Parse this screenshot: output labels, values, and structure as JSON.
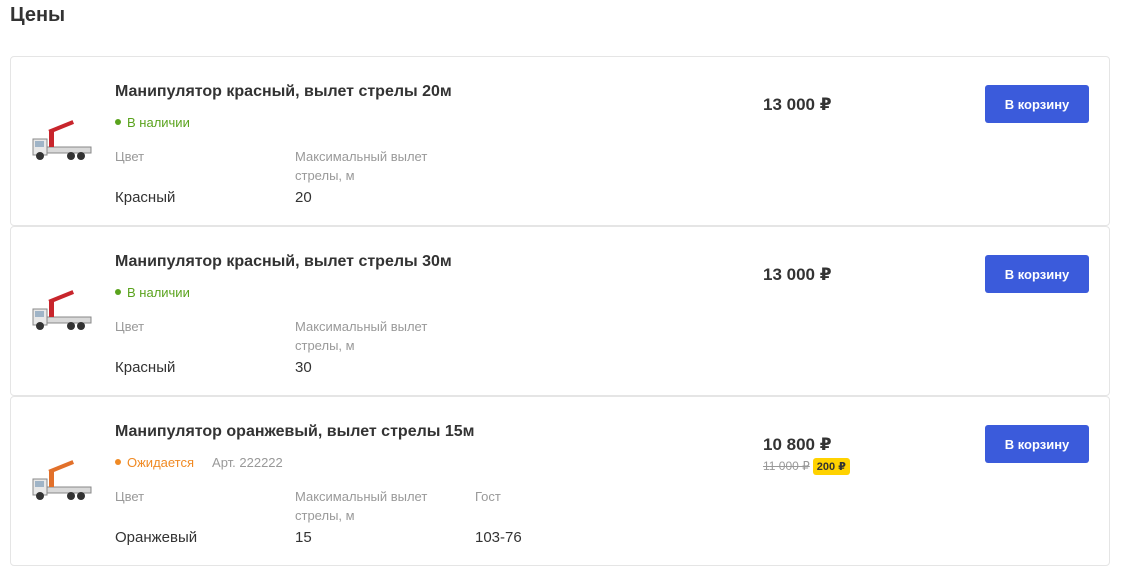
{
  "page": {
    "title": "Цены"
  },
  "products": [
    {
      "title": "Манипулятор красный, вылет стрелы 20м",
      "status": "В наличии",
      "status_type": "in-stock",
      "sku": "",
      "properties": [
        {
          "label": "Цвет",
          "value": "Красный"
        },
        {
          "label": "Максимальный вылет стрелы, м",
          "value": "20"
        }
      ],
      "price": "13 000 ₽",
      "old_price": "",
      "discount": "",
      "button_label": "В корзину",
      "crane_color": "#c8252c"
    },
    {
      "title": "Манипулятор красный, вылет стрелы 30м",
      "status": "В наличии",
      "status_type": "in-stock",
      "sku": "",
      "properties": [
        {
          "label": "Цвет",
          "value": "Красный"
        },
        {
          "label": "Максимальный вылет стрелы, м",
          "value": "30"
        }
      ],
      "price": "13 000 ₽",
      "old_price": "",
      "discount": "",
      "button_label": "В корзину",
      "crane_color": "#c8252c"
    },
    {
      "title": "Манипулятор оранжевый, вылет стрелы 15м",
      "status": "Ожидается",
      "status_type": "expected",
      "sku": "Арт. 222222",
      "properties": [
        {
          "label": "Цвет",
          "value": "Оранжевый"
        },
        {
          "label": "Максимальный вылет стрелы, м",
          "value": "15"
        },
        {
          "label": "Гост",
          "value": "103-76"
        }
      ],
      "price": "10 800 ₽",
      "old_price": "11 000 ₽",
      "discount": "200 ₽",
      "button_label": "В корзину",
      "crane_color": "#e2702a"
    }
  ],
  "colors": {
    "accent": "#3b5bdb",
    "in_stock": "#5aa31d",
    "expected": "#f08a24",
    "discount_badge": "#ffd200"
  }
}
